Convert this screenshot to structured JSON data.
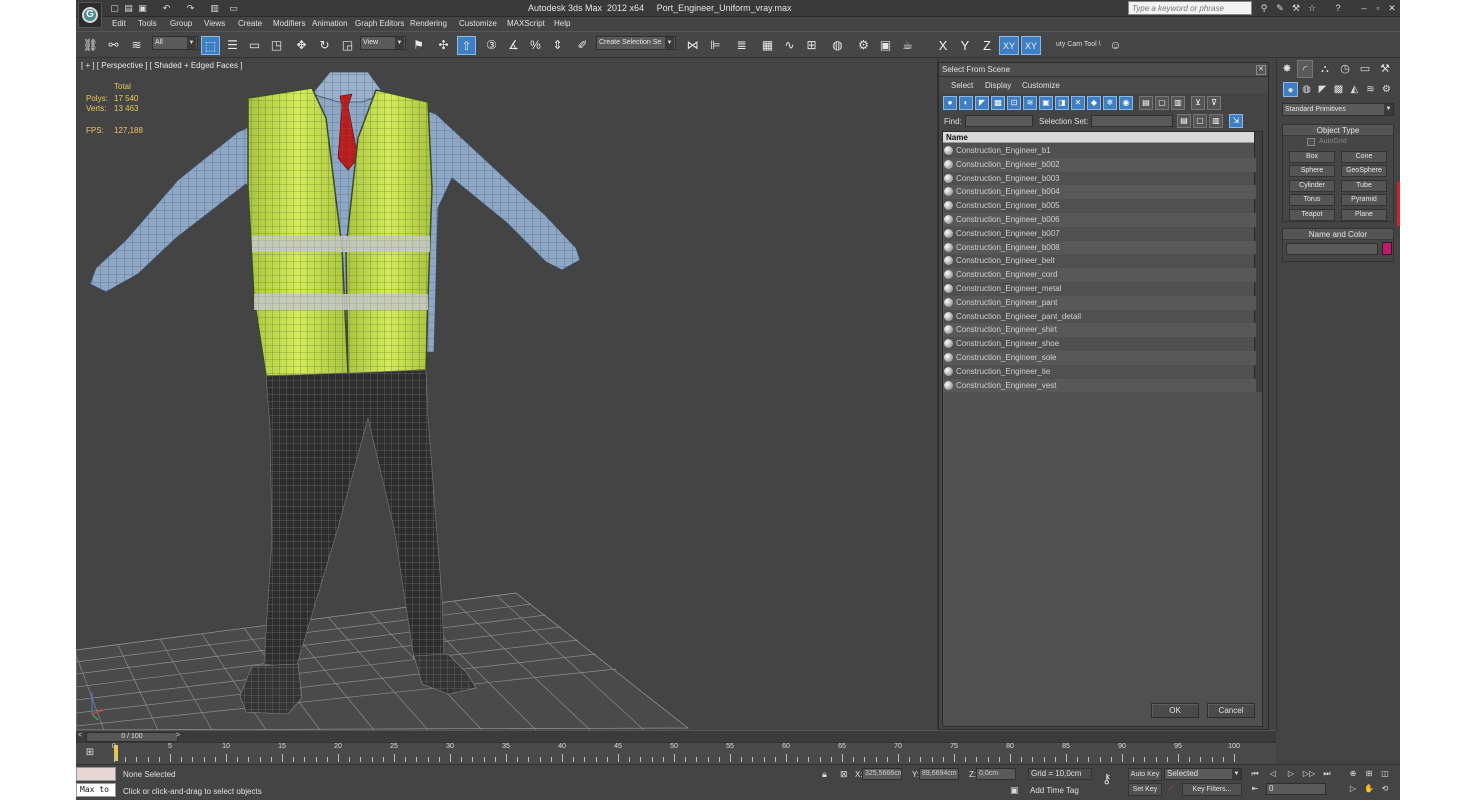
{
  "app": {
    "title": "Autodesk 3ds Max  2012 x64     Port_Engineer_Uniform_vray.max",
    "search_placeholder": "Type a keyword or phrase",
    "logo_letter": "G"
  },
  "menu": [
    "Edit",
    "Tools",
    "Group",
    "Views",
    "Create",
    "Modifiers",
    "Animation",
    "Graph Editors",
    "Rendering",
    "Customize",
    "MAXScript",
    "Help"
  ],
  "toolbar": {
    "filter_value": "All",
    "coord_value": "View",
    "selection_set": "Create Selection Se",
    "cam_tool_label": "uty Cam Tool \\",
    "axis": [
      "X",
      "Y",
      "Z",
      "XY",
      "XY"
    ]
  },
  "viewport": {
    "label": "[ + ] [ Perspective ] [ Shaded + Edged Faces ]",
    "stats": {
      "total_label": "Total",
      "polys_label": "Polys:",
      "polys_value": "17 540",
      "verts_label": "Verts:",
      "verts_value": "13 463",
      "fps_label": "FPS:",
      "fps_value": "127,188"
    }
  },
  "dialog": {
    "title": "Select From Scene",
    "menu": [
      "Select",
      "Display",
      "Customize"
    ],
    "find_label": "Find:",
    "selection_set_label": "Selection Set:",
    "column_name": "Name",
    "objects": [
      "Construction_Engineer_b1",
      "Construction_Engineer_b002",
      "Construction_Engineer_b003",
      "Construction_Engineer_b004",
      "Construction_Engineer_b005",
      "Construction_Engineer_b006",
      "Construction_Engineer_b007",
      "Construction_Engineer_b008",
      "Construction_Engineer_belt",
      "Construction_Engineer_cord",
      "Construction_Engineer_metal",
      "Construction_Engineer_pant",
      "Construction_Engineer_pant_detail",
      "Construction_Engineer_shirt",
      "Construction_Engineer_shoe",
      "Construction_Engineer_sole",
      "Construction_Engineer_tie",
      "Construction_Engineer_vest"
    ],
    "ok_label": "OK",
    "cancel_label": "Cancel"
  },
  "command_panel": {
    "category": "Standard Primitives",
    "object_type_title": "Object Type",
    "autogrid_label": "AutoGrid",
    "buttons": [
      "Box",
      "Cone",
      "Sphere",
      "GeoSphere",
      "Cylinder",
      "Tube",
      "Torus",
      "Pyramid",
      "Teapot",
      "Plane"
    ],
    "name_color_title": "Name and Color",
    "object_color": "#c4186e"
  },
  "timeline": {
    "frame_label": "0 / 100",
    "ticks": [
      "0",
      "5",
      "10",
      "15",
      "20",
      "25",
      "30",
      "35",
      "40",
      "45",
      "50",
      "55",
      "60",
      "65",
      "70",
      "75",
      "80",
      "85",
      "90",
      "95",
      "100"
    ]
  },
  "status": {
    "maxscript_label": "Max to",
    "selection": "None Selected",
    "prompt": "Click or click-and-drag to select objects",
    "x_label": "X:",
    "x_value": "325,5666cm",
    "y_label": "Y:",
    "y_value": "89,6694cm",
    "z_label": "Z:",
    "z_value": "0,0cm",
    "grid": "Grid = 10,0cm",
    "add_time_tag": "Add Time Tag",
    "auto_key": "Auto Key",
    "set_key": "Set Key",
    "selected_value": "Selected",
    "key_filters": "Key Filters...",
    "frame_value": "0"
  },
  "colors": {
    "accent_blue": "#3e7fc4",
    "vest_green": "#c8e24a",
    "shirt_blue": "#8ea7c4",
    "pants_dark": "#2e2e2e",
    "tie_red": "#b81c1c"
  }
}
